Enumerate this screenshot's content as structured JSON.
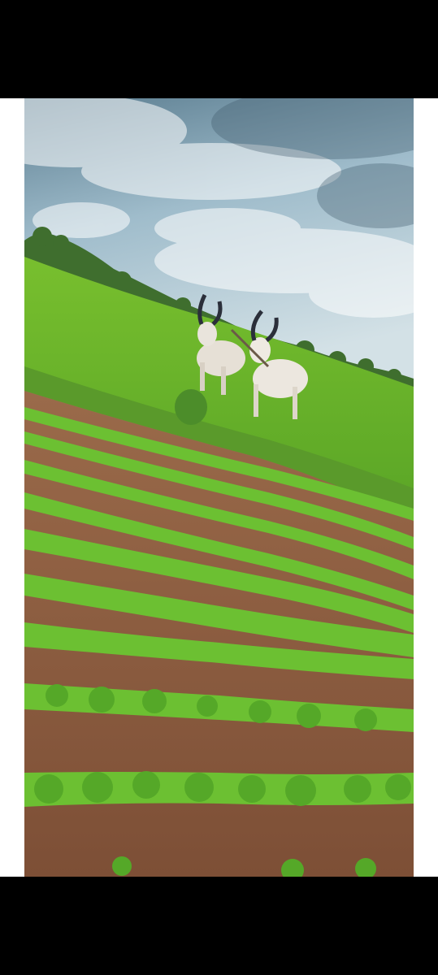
{
  "viewer": {
    "background": "#000000",
    "frame_color": "#ffffff"
  },
  "photo": {
    "subject_icon": "oxen-plough-field-photo",
    "colors": {
      "sky_top": "#4f6f82",
      "sky_bottom": "#c9dbe3",
      "field_green": "#6fb82e",
      "soil": "#8a5a3e",
      "ox": "#e9e4dc",
      "horn": "#2b2f3a"
    }
  }
}
